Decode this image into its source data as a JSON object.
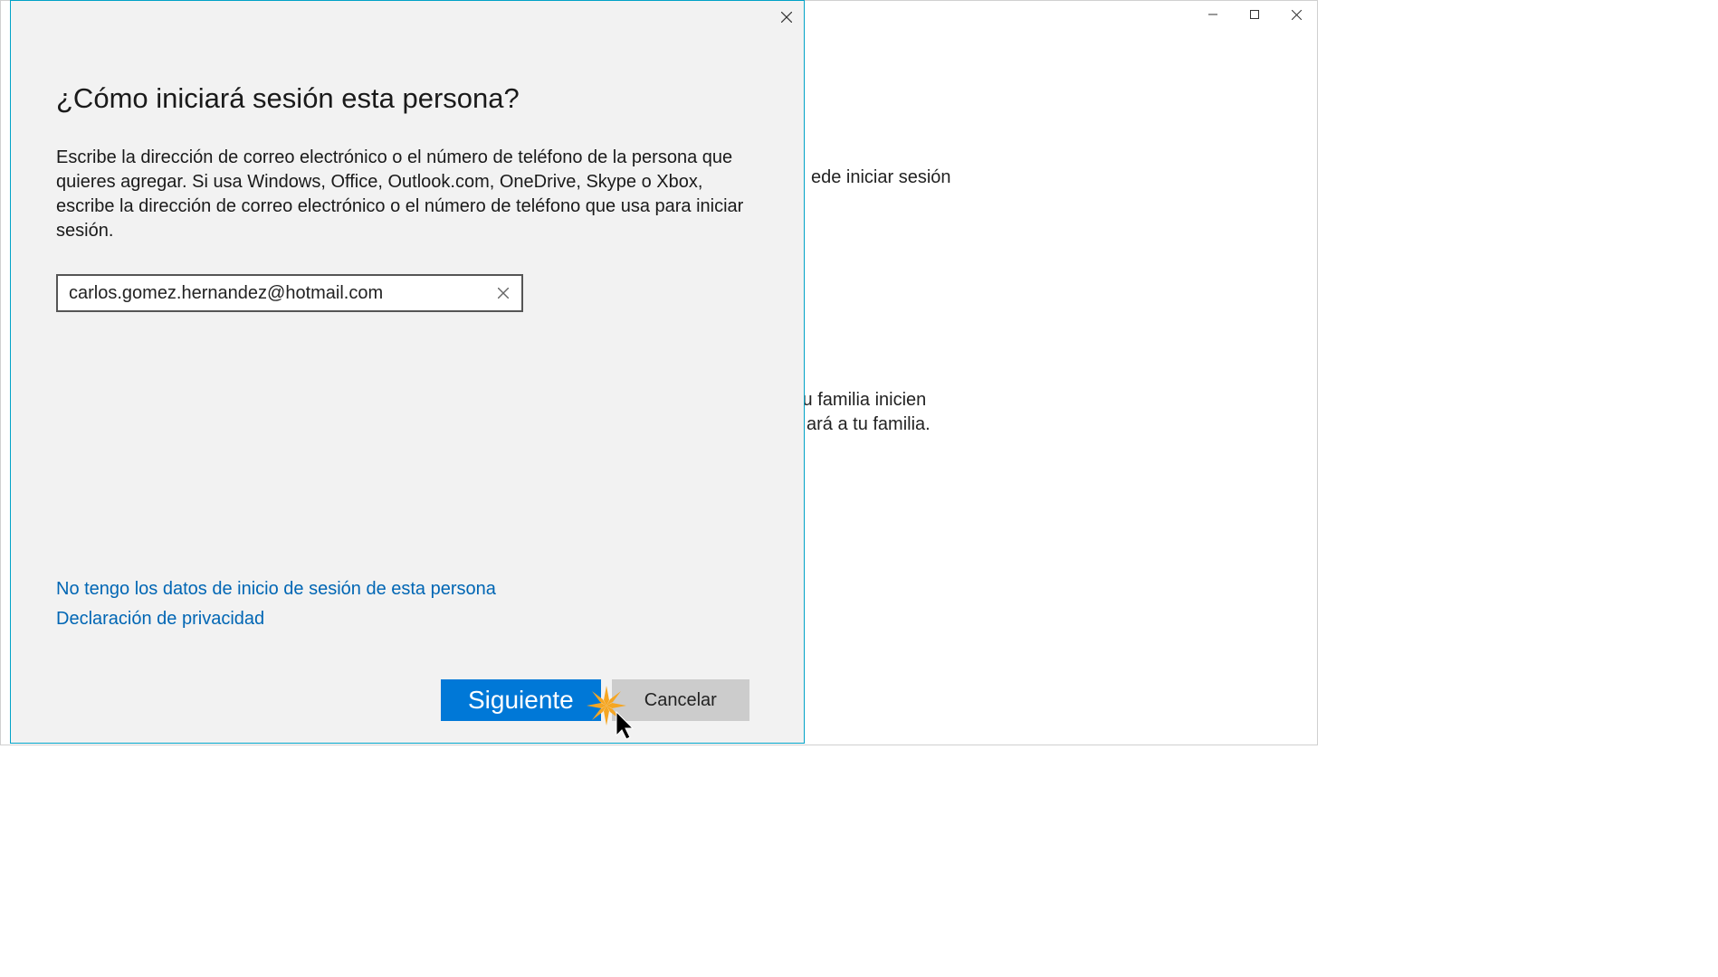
{
  "backWindow": {
    "partialText1": "ede iniciar sesión",
    "partialText2": "tu familia inicien",
    "partialText3": "ará a tu familia."
  },
  "dialog": {
    "heading": "¿Cómo iniciará sesión esta persona?",
    "description": "Escribe la dirección de correo electrónico o el número de teléfono de la persona que quieres agregar. Si usa Windows, Office, Outlook.com, OneDrive, Skype o Xbox, escribe la dirección de correo electrónico o el número de teléfono que usa para iniciar sesión.",
    "emailValue": "carlos.gomez.hernandez@hotmail.com",
    "linkNoCreds": "No tengo los datos de inicio de sesión de esta persona",
    "linkPrivacy": "Declaración de privacidad",
    "nextLabel": "Siguiente",
    "cancelLabel": "Cancelar"
  }
}
